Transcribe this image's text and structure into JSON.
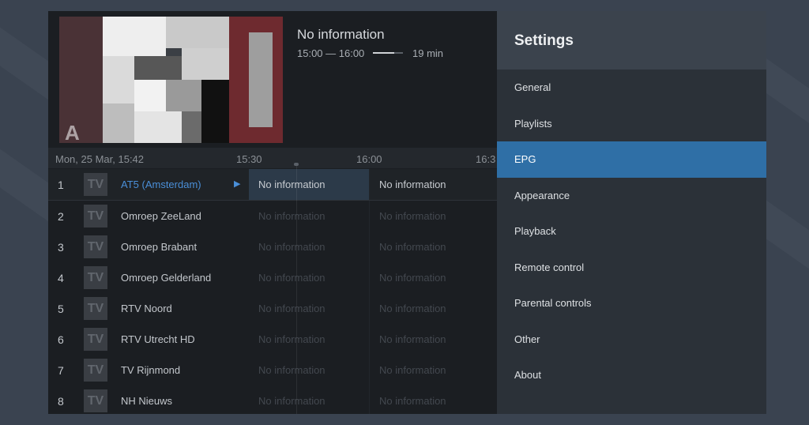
{
  "info": {
    "title": "No information",
    "time_range": "15:00 — 16:00",
    "progress_fraction": 0.7,
    "remaining": "19 min"
  },
  "preview": {
    "letter": "A"
  },
  "timeline": {
    "date_time": "Mon, 25 Mar, 15:42",
    "slots": [
      "15:30",
      "16:00",
      "16:3"
    ]
  },
  "channels": [
    {
      "num": "1",
      "logo": "TV",
      "name": "AT5 (Amsterdam)",
      "prog1": "No information",
      "prog2": "No information",
      "selected": true
    },
    {
      "num": "2",
      "logo": "TV",
      "name": "Omroep ZeeLand",
      "prog1": "No information",
      "prog2": "No information"
    },
    {
      "num": "3",
      "logo": "TV",
      "name": "Omroep Brabant",
      "prog1": "No information",
      "prog2": "No information"
    },
    {
      "num": "4",
      "logo": "TV",
      "name": "Omroep Gelderland",
      "prog1": "No information",
      "prog2": "No information"
    },
    {
      "num": "5",
      "logo": "TV",
      "name": "RTV Noord",
      "prog1": "No information",
      "prog2": "No information"
    },
    {
      "num": "6",
      "logo": "TV",
      "name": "RTV Utrecht HD",
      "prog1": "No information",
      "prog2": "No information"
    },
    {
      "num": "7",
      "logo": "TV",
      "name": "TV Rijnmond",
      "prog1": "No information",
      "prog2": "No information"
    },
    {
      "num": "8",
      "logo": "TV",
      "name": "NH Nieuws",
      "prog1": "No information",
      "prog2": "No information"
    }
  ],
  "settings": {
    "title": "Settings",
    "items": [
      "General",
      "Playlists",
      "EPG",
      "Appearance",
      "Playback",
      "Remote control",
      "Parental controls",
      "Other",
      "About"
    ],
    "active_index": 2
  },
  "colors": {
    "accent": "#2f6fa6",
    "highlight_text": "#4a8fd8"
  },
  "icons": {
    "play": "play-icon",
    "channel_logo": "tv-logo-icon"
  }
}
